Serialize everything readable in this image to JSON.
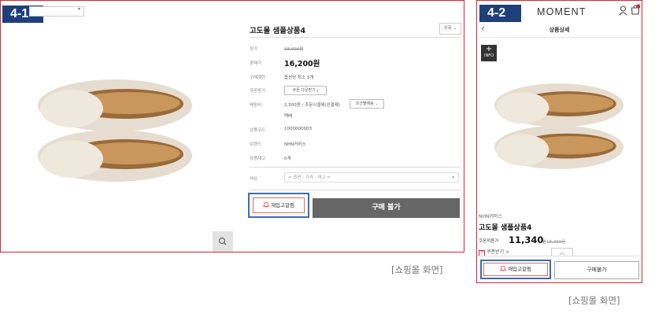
{
  "desktop": {
    "badge": "4-1",
    "product": {
      "title": "고도몰 샘플상품4",
      "share_label": "공유 ⌄",
      "rows": [
        {
          "label": "정가",
          "value": "18,000원"
        },
        {
          "label": "판매가",
          "value": "16,200원"
        },
        {
          "label": "구매제한",
          "value": "옵션당 최소 1개"
        },
        {
          "label": "쿠폰받기",
          "value": "쿠폰 다운받기 ⤓"
        },
        {
          "label": "배송비",
          "value": "2,500원  / 주문시결제(선결제)"
        },
        {
          "label": "",
          "value": "택배"
        },
        {
          "label": "상품코드",
          "value": "1000000003"
        },
        {
          "label": "브랜드",
          "value": "NHN커머스"
        },
        {
          "label": "상품재고",
          "value": "0개"
        },
        {
          "label": "색상",
          "value": "= 옵션 : 가격 : 재고 ="
        }
      ],
      "condition_btn": "조건별배송 ⌄",
      "restock_label": "재입고알림",
      "buy_label": "구매 불가"
    },
    "caption": "[쇼핑몰 화면]"
  },
  "mobile": {
    "badge": "4-2",
    "brand": "MOMENT",
    "header_title": "상품상세",
    "info_label": "INFO",
    "seller": "NHN커머스",
    "title": "고도몰 샘플상품4",
    "price_label": "쿠폰적용가",
    "price": "11,340",
    "price_unit": "원",
    "old_price": "18,200원",
    "coupon_badge": "쿠",
    "coupon_label": "쿠폰받기 >",
    "restock_label": "재입고알림",
    "buy_label": "구매불가",
    "caption": "[쇼핑몰 화면]"
  }
}
